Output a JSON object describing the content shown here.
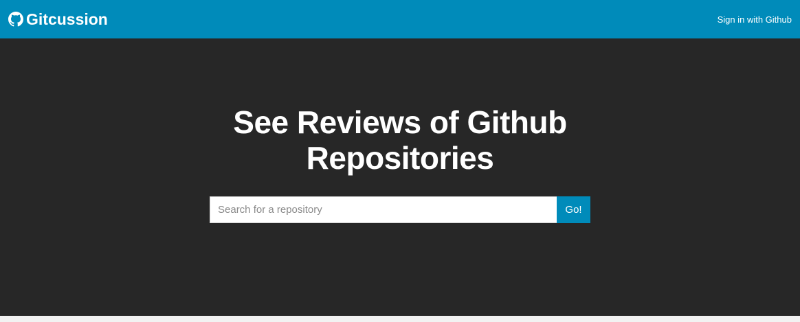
{
  "navbar": {
    "brand_name": "Gitcussion",
    "brand_icon": "github-icon",
    "signin_label": "Sign in with Github",
    "background_color": "#008bba"
  },
  "hero": {
    "title_line1": "See Reviews of Github",
    "title_line2": "Repositories",
    "background_color": "#272727"
  },
  "search": {
    "placeholder": "Search for a repository",
    "value": "",
    "button_label": "Go!"
  }
}
